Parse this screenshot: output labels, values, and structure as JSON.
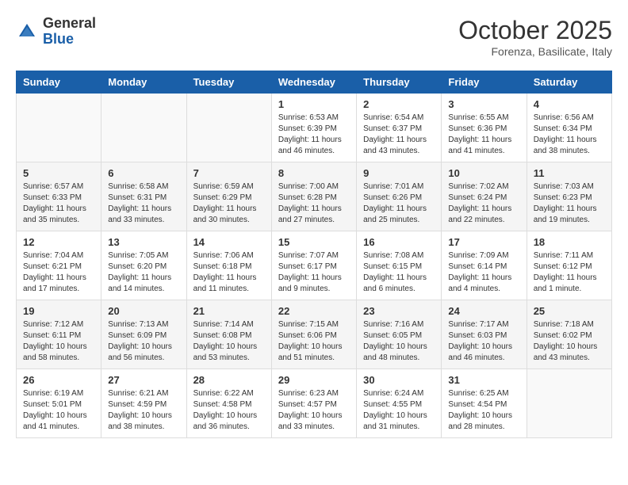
{
  "header": {
    "logo_general": "General",
    "logo_blue": "Blue",
    "month_title": "October 2025",
    "location": "Forenza, Basilicate, Italy"
  },
  "days_of_week": [
    "Sunday",
    "Monday",
    "Tuesday",
    "Wednesday",
    "Thursday",
    "Friday",
    "Saturday"
  ],
  "weeks": [
    [
      {
        "day": "",
        "info": ""
      },
      {
        "day": "",
        "info": ""
      },
      {
        "day": "",
        "info": ""
      },
      {
        "day": "1",
        "info": "Sunrise: 6:53 AM\nSunset: 6:39 PM\nDaylight: 11 hours\nand 46 minutes."
      },
      {
        "day": "2",
        "info": "Sunrise: 6:54 AM\nSunset: 6:37 PM\nDaylight: 11 hours\nand 43 minutes."
      },
      {
        "day": "3",
        "info": "Sunrise: 6:55 AM\nSunset: 6:36 PM\nDaylight: 11 hours\nand 41 minutes."
      },
      {
        "day": "4",
        "info": "Sunrise: 6:56 AM\nSunset: 6:34 PM\nDaylight: 11 hours\nand 38 minutes."
      }
    ],
    [
      {
        "day": "5",
        "info": "Sunrise: 6:57 AM\nSunset: 6:33 PM\nDaylight: 11 hours\nand 35 minutes."
      },
      {
        "day": "6",
        "info": "Sunrise: 6:58 AM\nSunset: 6:31 PM\nDaylight: 11 hours\nand 33 minutes."
      },
      {
        "day": "7",
        "info": "Sunrise: 6:59 AM\nSunset: 6:29 PM\nDaylight: 11 hours\nand 30 minutes."
      },
      {
        "day": "8",
        "info": "Sunrise: 7:00 AM\nSunset: 6:28 PM\nDaylight: 11 hours\nand 27 minutes."
      },
      {
        "day": "9",
        "info": "Sunrise: 7:01 AM\nSunset: 6:26 PM\nDaylight: 11 hours\nand 25 minutes."
      },
      {
        "day": "10",
        "info": "Sunrise: 7:02 AM\nSunset: 6:24 PM\nDaylight: 11 hours\nand 22 minutes."
      },
      {
        "day": "11",
        "info": "Sunrise: 7:03 AM\nSunset: 6:23 PM\nDaylight: 11 hours\nand 19 minutes."
      }
    ],
    [
      {
        "day": "12",
        "info": "Sunrise: 7:04 AM\nSunset: 6:21 PM\nDaylight: 11 hours\nand 17 minutes."
      },
      {
        "day": "13",
        "info": "Sunrise: 7:05 AM\nSunset: 6:20 PM\nDaylight: 11 hours\nand 14 minutes."
      },
      {
        "day": "14",
        "info": "Sunrise: 7:06 AM\nSunset: 6:18 PM\nDaylight: 11 hours\nand 11 minutes."
      },
      {
        "day": "15",
        "info": "Sunrise: 7:07 AM\nSunset: 6:17 PM\nDaylight: 11 hours\nand 9 minutes."
      },
      {
        "day": "16",
        "info": "Sunrise: 7:08 AM\nSunset: 6:15 PM\nDaylight: 11 hours\nand 6 minutes."
      },
      {
        "day": "17",
        "info": "Sunrise: 7:09 AM\nSunset: 6:14 PM\nDaylight: 11 hours\nand 4 minutes."
      },
      {
        "day": "18",
        "info": "Sunrise: 7:11 AM\nSunset: 6:12 PM\nDaylight: 11 hours\nand 1 minute."
      }
    ],
    [
      {
        "day": "19",
        "info": "Sunrise: 7:12 AM\nSunset: 6:11 PM\nDaylight: 10 hours\nand 58 minutes."
      },
      {
        "day": "20",
        "info": "Sunrise: 7:13 AM\nSunset: 6:09 PM\nDaylight: 10 hours\nand 56 minutes."
      },
      {
        "day": "21",
        "info": "Sunrise: 7:14 AM\nSunset: 6:08 PM\nDaylight: 10 hours\nand 53 minutes."
      },
      {
        "day": "22",
        "info": "Sunrise: 7:15 AM\nSunset: 6:06 PM\nDaylight: 10 hours\nand 51 minutes."
      },
      {
        "day": "23",
        "info": "Sunrise: 7:16 AM\nSunset: 6:05 PM\nDaylight: 10 hours\nand 48 minutes."
      },
      {
        "day": "24",
        "info": "Sunrise: 7:17 AM\nSunset: 6:03 PM\nDaylight: 10 hours\nand 46 minutes."
      },
      {
        "day": "25",
        "info": "Sunrise: 7:18 AM\nSunset: 6:02 PM\nDaylight: 10 hours\nand 43 minutes."
      }
    ],
    [
      {
        "day": "26",
        "info": "Sunrise: 6:19 AM\nSunset: 5:01 PM\nDaylight: 10 hours\nand 41 minutes."
      },
      {
        "day": "27",
        "info": "Sunrise: 6:21 AM\nSunset: 4:59 PM\nDaylight: 10 hours\nand 38 minutes."
      },
      {
        "day": "28",
        "info": "Sunrise: 6:22 AM\nSunset: 4:58 PM\nDaylight: 10 hours\nand 36 minutes."
      },
      {
        "day": "29",
        "info": "Sunrise: 6:23 AM\nSunset: 4:57 PM\nDaylight: 10 hours\nand 33 minutes."
      },
      {
        "day": "30",
        "info": "Sunrise: 6:24 AM\nSunset: 4:55 PM\nDaylight: 10 hours\nand 31 minutes."
      },
      {
        "day": "31",
        "info": "Sunrise: 6:25 AM\nSunset: 4:54 PM\nDaylight: 10 hours\nand 28 minutes."
      },
      {
        "day": "",
        "info": ""
      }
    ]
  ]
}
